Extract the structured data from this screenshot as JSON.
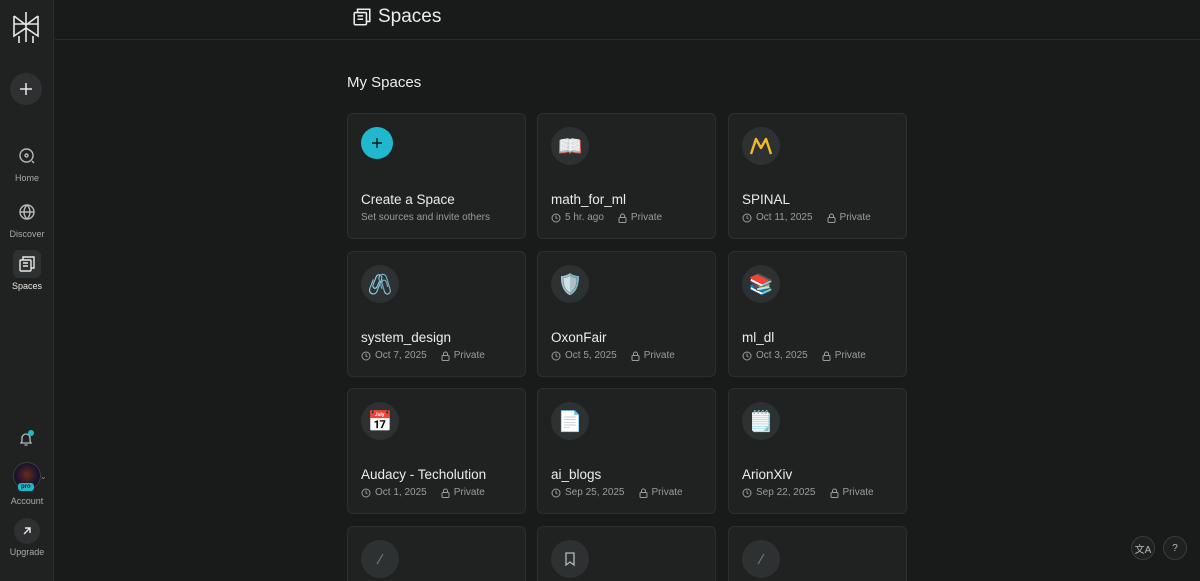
{
  "sidebar": {
    "nav": [
      {
        "label": "Home",
        "icon": "home-icon"
      },
      {
        "label": "Discover",
        "icon": "globe-icon"
      },
      {
        "label": "Spaces",
        "icon": "spaces-icon"
      }
    ],
    "account_label": "Account",
    "pro_badge": "pro",
    "upgrade_label": "Upgrade"
  },
  "header": {
    "title": "Spaces"
  },
  "main": {
    "section_title": "My Spaces",
    "create_card": {
      "title": "Create a Space",
      "subtitle": "Set sources and invite others"
    },
    "spaces": [
      {
        "title": "math_for_ml",
        "date": "5 hr. ago",
        "privacy": "Private",
        "emoji": "📖"
      },
      {
        "title": "SPINAL",
        "date": "Oct 11, 2025",
        "privacy": "Private",
        "emoji": "M"
      },
      {
        "title": "system_design",
        "date": "Oct 7, 2025",
        "privacy": "Private",
        "emoji": "🖇️"
      },
      {
        "title": "OxonFair",
        "date": "Oct 5, 2025",
        "privacy": "Private",
        "emoji": "🛡️"
      },
      {
        "title": "ml_dl",
        "date": "Oct 3, 2025",
        "privacy": "Private",
        "emoji": "📚"
      },
      {
        "title": "Audacy - Techolution",
        "date": "Oct 1, 2025",
        "privacy": "Private",
        "emoji": "📅"
      },
      {
        "title": "ai_blogs",
        "date": "Sep 25, 2025",
        "privacy": "Private",
        "emoji": "📄"
      },
      {
        "title": "ArionXiv",
        "date": "Sep 22, 2025",
        "privacy": "Private",
        "emoji": "🗒️"
      }
    ]
  },
  "corner": {
    "translate_label": "文A",
    "help_label": "?"
  },
  "colors": {
    "accent": "#20b8cd",
    "background": "#191a1a",
    "card": "#202222"
  }
}
